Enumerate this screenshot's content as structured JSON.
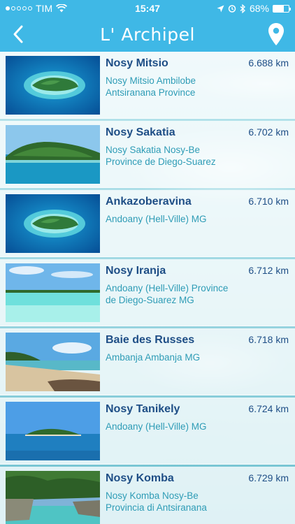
{
  "status_bar": {
    "carrier": "TIM",
    "time": "15:47",
    "battery": "68%",
    "battery_level": 0.68
  },
  "nav": {
    "title": "L' Archipel",
    "back_icon": "chevron-left-icon",
    "map_icon": "map-pin-icon"
  },
  "places": [
    {
      "name": "Nosy Mitsio",
      "address": "Nosy Mitsio Ambilobe Antsiranana Province",
      "distance": "6.688 km",
      "photo": "island-aerial-reef"
    },
    {
      "name": "Nosy Sakatia",
      "address": "Nosy Sakatia Nosy-Be Province de Diego-Suarez",
      "distance": "6.702 km",
      "photo": "island-green-hill"
    },
    {
      "name": "Ankazoberavina",
      "address": "Andoany (Hell-Ville) MG",
      "distance": "6.710 km",
      "photo": "island-aerial-reef"
    },
    {
      "name": "Nosy Iranja",
      "address": "Andoany (Hell-Ville) Province de Diego-Suarez MG",
      "distance": "6.712 km",
      "photo": "lagoon-turquoise"
    },
    {
      "name": "Baie des Russes",
      "address": "Ambanja Ambanja MG",
      "distance": "6.718 km",
      "photo": "sandy-beach"
    },
    {
      "name": "Nosy Tanikely",
      "address": "Andoany (Hell-Ville) MG",
      "distance": "6.724 km",
      "photo": "island-horizon"
    },
    {
      "name": "Nosy Komba",
      "address": "Nosy Komba Nosy-Be Provincia di Antsiranana",
      "distance": "6.729 km",
      "photo": "rocky-cove"
    }
  ]
}
